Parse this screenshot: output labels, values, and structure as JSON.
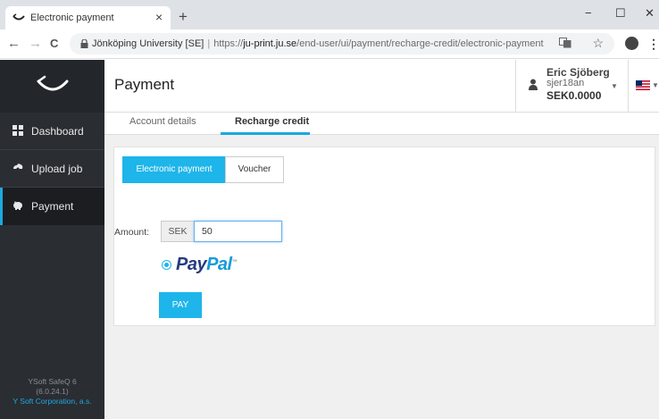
{
  "browser": {
    "tab_title": "Electronic payment",
    "tab_close": "×",
    "new_tab": "+",
    "window_controls": {
      "minimize": "−",
      "maximize": "☐",
      "close": "✕"
    },
    "nav": {
      "back": "←",
      "forward": "→",
      "reload": "C"
    },
    "url": {
      "site": "Jönköping University [SE]",
      "separator": "|",
      "scheme": "https://",
      "host": "ju-print.ju.se",
      "path": "/end-user/ui/payment/recharge-credit/electronic-payment"
    },
    "menu": "⋮",
    "icons": {
      "lock": "lock-icon",
      "translate": "translate-icon",
      "star": "star-icon",
      "account": "account-icon"
    }
  },
  "sidebar": {
    "items": [
      {
        "label": "Dashboard",
        "icon": "grid-icon"
      },
      {
        "label": "Upload job",
        "icon": "upload-icon"
      },
      {
        "label": "Payment",
        "icon": "piggy-bank-icon",
        "active": true
      }
    ],
    "footer": {
      "line1": "YSoft SafeQ 6",
      "line2": "(6.0.24.1)",
      "line3": "Y Soft Corporation, a.s."
    }
  },
  "header": {
    "title": "Payment",
    "user": {
      "name": "Eric Sjöberg",
      "login": "sjer18an",
      "balance": "SEK0.0000"
    },
    "language_flag": "us-flag-icon"
  },
  "tabs": [
    {
      "label": "Account details",
      "active": false
    },
    {
      "label": "Recharge credit",
      "active": true
    }
  ],
  "recharge": {
    "methods": [
      {
        "label": "Electronic payment",
        "active": true
      },
      {
        "label": "Voucher",
        "active": false
      }
    ],
    "amount_label": "Amount:",
    "currency": "SEK",
    "amount_value": "50",
    "paypal": {
      "pay": "Pay",
      "pal": "Pal",
      "tm": "™"
    },
    "pay_button": "PAY"
  },
  "colors": {
    "accent": "#1eb5ea",
    "sidebar_bg": "#2a2d32",
    "paypal_dark": "#253b80",
    "paypal_light": "#179bd7"
  }
}
